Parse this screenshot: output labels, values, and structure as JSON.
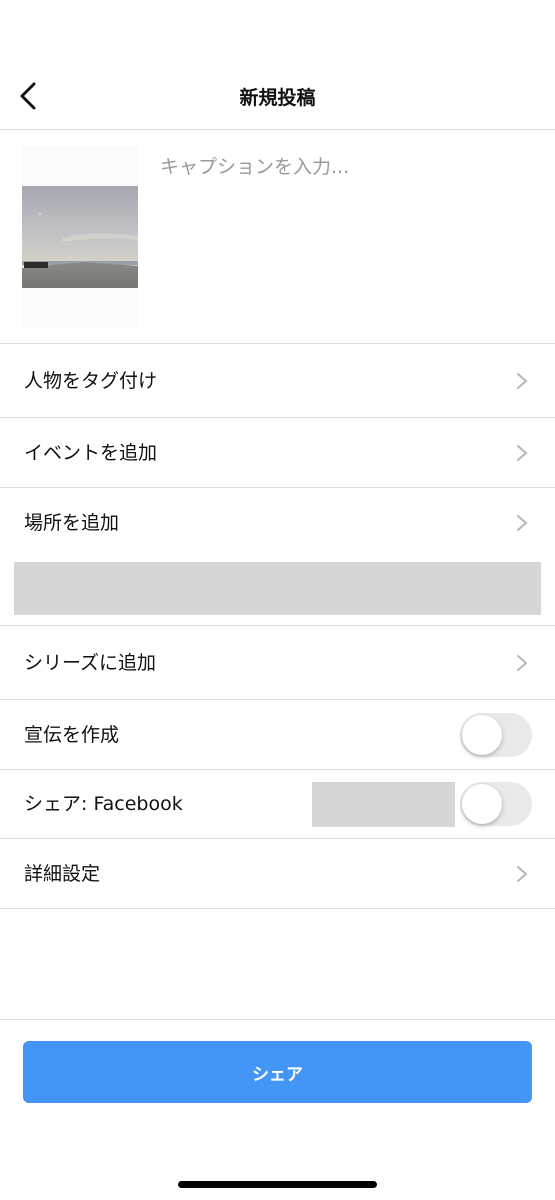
{
  "header": {
    "title": "新規投稿",
    "back_icon": "chevron-left-icon"
  },
  "compose": {
    "caption_placeholder": "キャプションを入力...",
    "caption_value": ""
  },
  "options": {
    "tag_people": "人物をタグ付け",
    "add_event": "イベントを追加",
    "add_location": "場所を追加",
    "add_to_series": "シリーズに追加",
    "create_promotion": "宣伝を作成",
    "share_facebook": "シェア: Facebook",
    "advanced_settings": "詳細設定"
  },
  "toggles": {
    "create_promotion_on": false,
    "share_facebook_on": false
  },
  "footer": {
    "share_button": "シェア"
  },
  "colors": {
    "accent": "#4396f5",
    "divider": "#dbdbdb",
    "toggle_off": "#e9e9ea",
    "placeholder_text": "#9a9a9a"
  }
}
